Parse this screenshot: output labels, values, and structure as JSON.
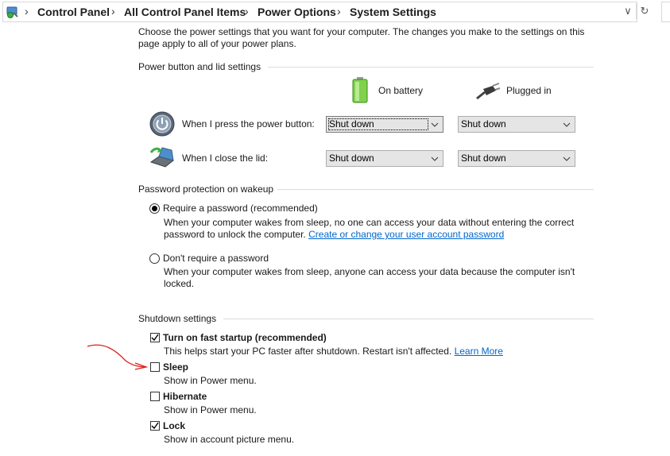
{
  "address": {
    "crumbs": [
      "Control Panel",
      "All Control Panel Items",
      "Power Options",
      "System Settings"
    ]
  },
  "intro": {
    "line1": "Choose the power settings that you want for your computer. The changes you make to the settings on this",
    "line2": "page apply to all of your power plans."
  },
  "power_section": {
    "title": "Power button and lid settings",
    "col_battery": "On battery",
    "col_plugged": "Plugged in",
    "rows": [
      {
        "label": "When I press the power button:",
        "battery": "Shut down",
        "plugged": "Shut down"
      },
      {
        "label": "When I close the lid:",
        "battery": "Shut down",
        "plugged": "Shut down"
      }
    ]
  },
  "password_section": {
    "title": "Password protection on wakeup",
    "require": {
      "label": "Require a password (recommended)",
      "checked": true,
      "desc1": "When your computer wakes from sleep, no one can access your data without entering the correct",
      "desc2_prefix": "password to unlock the computer. ",
      "link": "Create or change your user account password"
    },
    "no_require": {
      "label": "Don't require a password",
      "checked": false,
      "desc1": "When your computer wakes from sleep, anyone can access your data because the computer isn't",
      "desc2": "locked."
    }
  },
  "shutdown_section": {
    "title": "Shutdown settings",
    "items": [
      {
        "label": "Turn on fast startup (recommended)",
        "checked": true,
        "desc": "This helps start your PC faster after shutdown. Restart isn't affected. ",
        "link": "Learn More"
      },
      {
        "label": "Sleep",
        "checked": false,
        "desc": "Show in Power menu."
      },
      {
        "label": "Hibernate",
        "checked": false,
        "desc": "Show in Power menu."
      },
      {
        "label": "Lock",
        "checked": true,
        "desc": "Show in account picture menu."
      }
    ]
  },
  "colors": {
    "link": "#0066cc",
    "annotation": "#e0201b"
  }
}
